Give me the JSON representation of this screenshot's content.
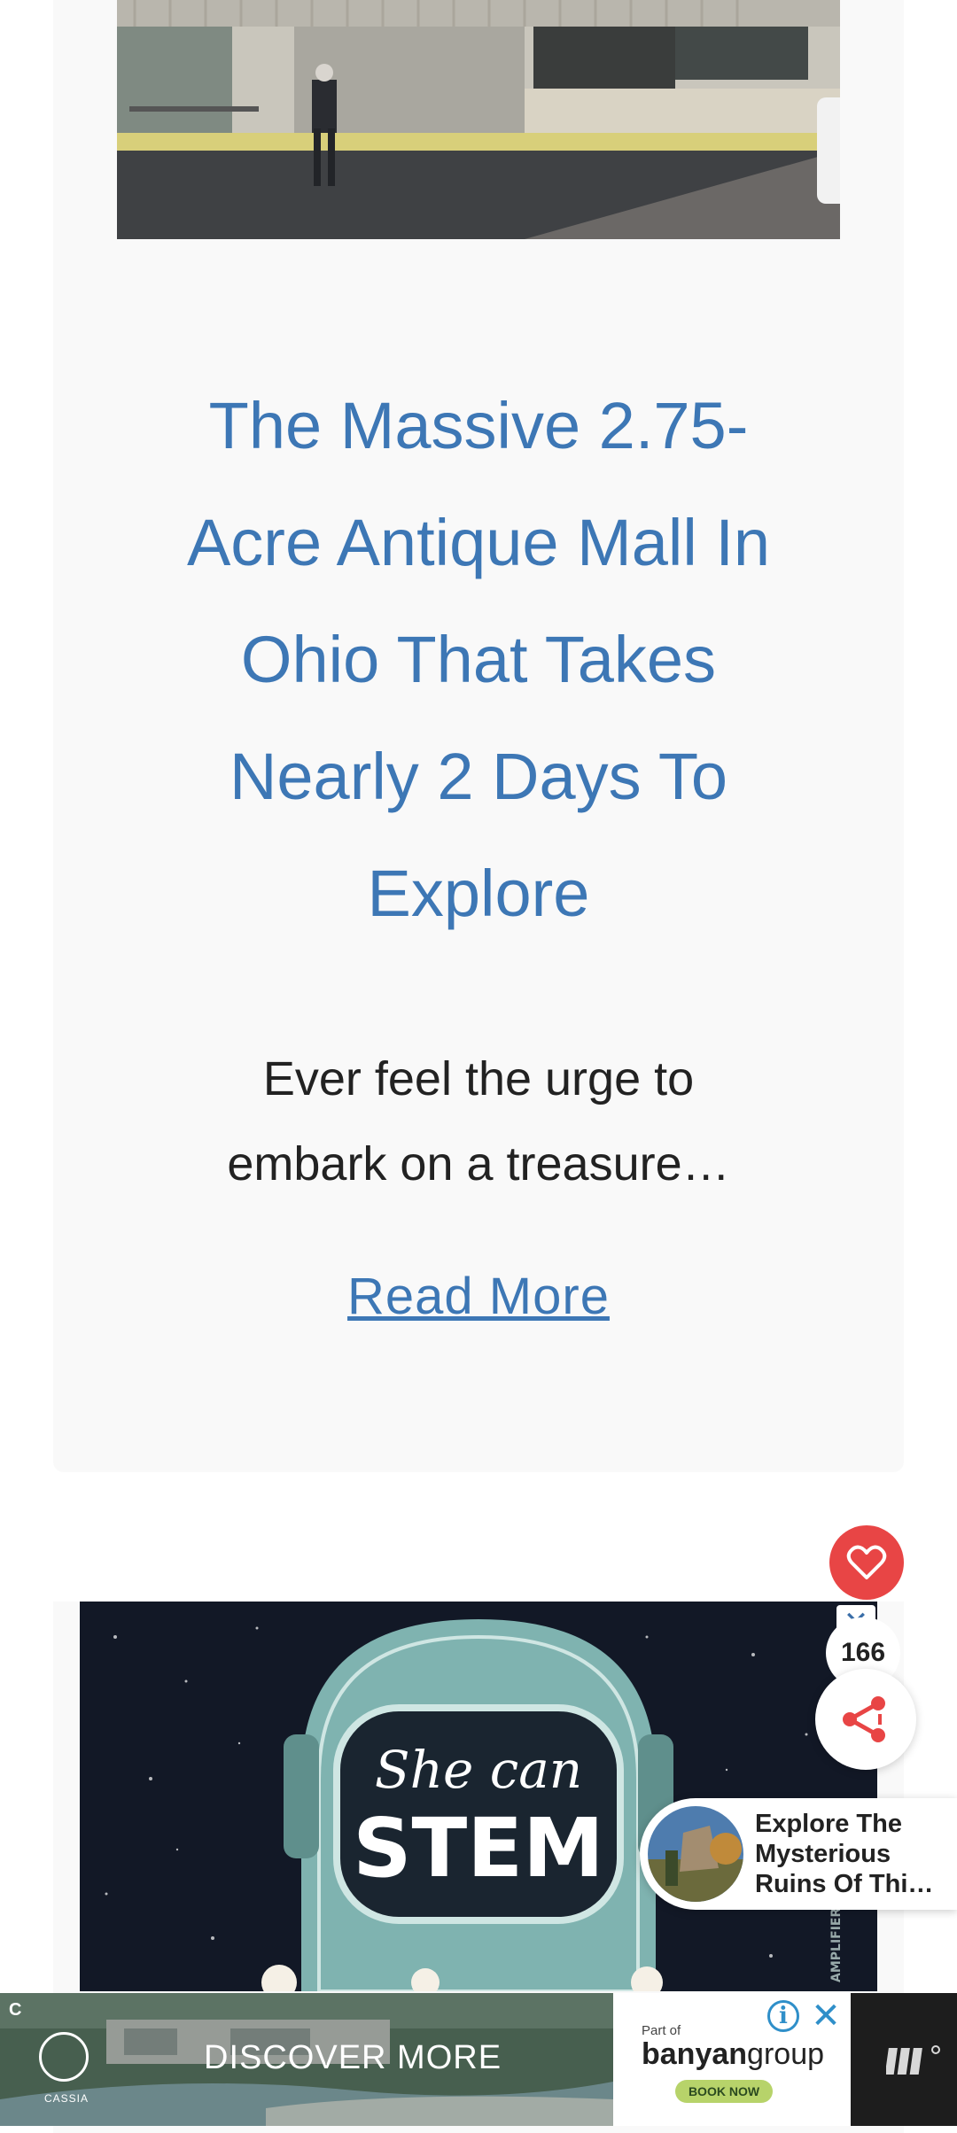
{
  "article": {
    "title": "The Massive 2.75-Acre Antique Mall In Ohio That Takes Nearly 2 Days To Explore",
    "excerpt": "Ever feel the urge to embark on a treasure…",
    "read_more": "Read More"
  },
  "next_card_ad": {
    "line1": "She can",
    "line2": "STEM",
    "side_text": "AMPLIFIER.ORG",
    "close_label": "✕"
  },
  "engagement": {
    "share_count": "166",
    "heart_color": "#e84545"
  },
  "recommendation": {
    "text": "Explore The\nMysterious\nRuins Of Thi…"
  },
  "bottom_ad": {
    "brand_left": "CASSIA",
    "cta": "DISCOVER MORE",
    "part_of": "Part of",
    "brand_bold": "banyan",
    "brand_light": "group",
    "book_now": "BOOK NOW",
    "info_label": "i",
    "close_label": "✕"
  },
  "colors": {
    "link_blue": "#3d77b5",
    "card_bg": "#f9f9f9",
    "share_red": "#e84545"
  }
}
